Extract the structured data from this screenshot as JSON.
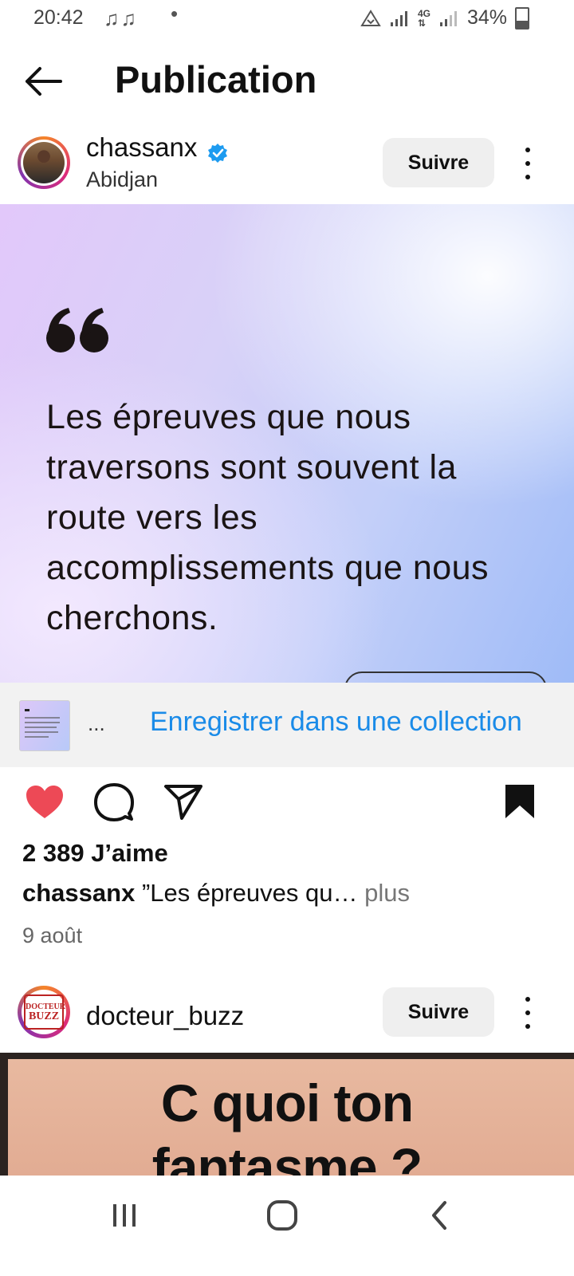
{
  "status_bar": {
    "time": "20:42",
    "notifications": "♫♫",
    "network": "4G",
    "battery": "34%"
  },
  "header": {
    "title": "Publication"
  },
  "post": {
    "username": "chassanx",
    "location": "Abidjan",
    "follow_label": "Suivre",
    "verified": true,
    "quote_mark": "“",
    "quote_text": "Les épreuves que nous traversons sont souvent la route vers les accomplissements que nous cherchons.",
    "collection": {
      "ellipsis": "...",
      "link_label": "Enregistrer dans une collection"
    },
    "liked": true,
    "saved": true,
    "likes_text": "2 389 J’aime",
    "caption_user": "chassanx",
    "caption_text": "”Les épreuves qu…",
    "caption_more": "plus",
    "date": "9 août"
  },
  "next_post": {
    "username": "docteur_buzz",
    "follow_label": "Suivre",
    "logo_text_line1": "DOCTEUR",
    "logo_text_line2": "BUZZ",
    "image_text_line1": "C quoi ton",
    "image_text_line2": "fantasme ?"
  },
  "colors": {
    "link_blue": "#1a8be8",
    "like_red": "#ed4956",
    "verified_blue": "#1d9bf0",
    "follow_bg": "#efefef"
  }
}
